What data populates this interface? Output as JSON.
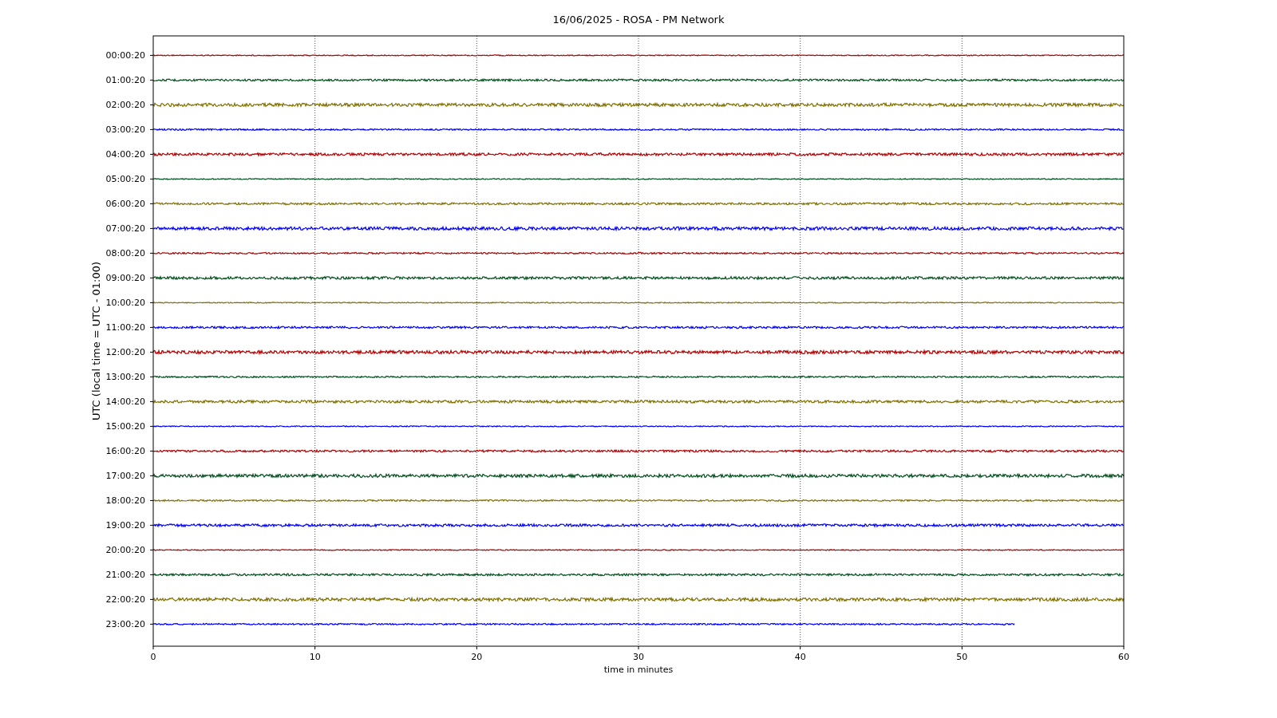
{
  "title": "16/06/2025 - ROSA - PM Network",
  "ylabel": "UTC (local time = UTC - 01:00)",
  "xlabel": "time in minutes",
  "xticks": [
    "0",
    "10",
    "20",
    "30",
    "40",
    "50",
    "60"
  ],
  "rows": [
    {
      "label": "00:00:20",
      "color": "#b40000",
      "level": 1
    },
    {
      "label": "01:00:20",
      "color": "#00501e",
      "level": 1
    },
    {
      "label": "02:00:20",
      "color": "#807000",
      "level": 1
    },
    {
      "label": "03:00:20",
      "color": "#0000ff",
      "level": 1
    },
    {
      "label": "04:00:20",
      "color": "#b40000",
      "level": 1
    },
    {
      "label": "05:00:20",
      "color": "#00501e",
      "level": 1
    },
    {
      "label": "06:00:20",
      "color": "#807000",
      "level": 1
    },
    {
      "label": "07:00:20",
      "color": "#0000ff",
      "level": 1
    },
    {
      "label": "08:00:20",
      "color": "#b40000",
      "level": 1
    },
    {
      "label": "09:00:20",
      "color": "#00501e",
      "level": 1
    },
    {
      "label": "10:00:20",
      "color": "#807000",
      "level": 1
    },
    {
      "label": "11:00:20",
      "color": "#0000ff",
      "level": 1
    },
    {
      "label": "12:00:20",
      "color": "#b40000",
      "level": 1
    },
    {
      "label": "13:00:20",
      "color": "#00501e",
      "level": 1
    },
    {
      "label": "14:00:20",
      "color": "#807000",
      "level": 1
    },
    {
      "label": "15:00:20",
      "color": "#0000ff",
      "level": 1
    },
    {
      "label": "16:00:20",
      "color": "#b40000",
      "level": 1
    },
    {
      "label": "17:00:20",
      "color": "#00501e",
      "level": 1
    },
    {
      "label": "18:00:20",
      "color": "#807000",
      "level": 1
    },
    {
      "label": "19:00:20",
      "color": "#0000ff",
      "level": 1
    },
    {
      "label": "20:00:20",
      "color": "#b40000",
      "level": 1
    },
    {
      "label": "21:00:20",
      "color": "#00501e",
      "level": 1
    },
    {
      "label": "22:00:20",
      "color": "#807000",
      "level": 1
    },
    {
      "label": "23:00:20",
      "color": "#0000ff",
      "level": 0.888
    }
  ]
}
